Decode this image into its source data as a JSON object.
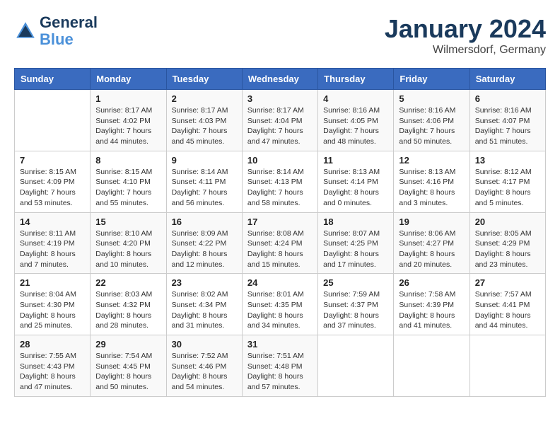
{
  "header": {
    "logo_line1": "General",
    "logo_line2": "Blue",
    "month": "January 2024",
    "location": "Wilmersdorf, Germany"
  },
  "weekdays": [
    "Sunday",
    "Monday",
    "Tuesday",
    "Wednesday",
    "Thursday",
    "Friday",
    "Saturday"
  ],
  "weeks": [
    [
      {
        "num": "",
        "info": ""
      },
      {
        "num": "1",
        "info": "Sunrise: 8:17 AM\nSunset: 4:02 PM\nDaylight: 7 hours\nand 44 minutes."
      },
      {
        "num": "2",
        "info": "Sunrise: 8:17 AM\nSunset: 4:03 PM\nDaylight: 7 hours\nand 45 minutes."
      },
      {
        "num": "3",
        "info": "Sunrise: 8:17 AM\nSunset: 4:04 PM\nDaylight: 7 hours\nand 47 minutes."
      },
      {
        "num": "4",
        "info": "Sunrise: 8:16 AM\nSunset: 4:05 PM\nDaylight: 7 hours\nand 48 minutes."
      },
      {
        "num": "5",
        "info": "Sunrise: 8:16 AM\nSunset: 4:06 PM\nDaylight: 7 hours\nand 50 minutes."
      },
      {
        "num": "6",
        "info": "Sunrise: 8:16 AM\nSunset: 4:07 PM\nDaylight: 7 hours\nand 51 minutes."
      }
    ],
    [
      {
        "num": "7",
        "info": "Sunrise: 8:15 AM\nSunset: 4:09 PM\nDaylight: 7 hours\nand 53 minutes."
      },
      {
        "num": "8",
        "info": "Sunrise: 8:15 AM\nSunset: 4:10 PM\nDaylight: 7 hours\nand 55 minutes."
      },
      {
        "num": "9",
        "info": "Sunrise: 8:14 AM\nSunset: 4:11 PM\nDaylight: 7 hours\nand 56 minutes."
      },
      {
        "num": "10",
        "info": "Sunrise: 8:14 AM\nSunset: 4:13 PM\nDaylight: 7 hours\nand 58 minutes."
      },
      {
        "num": "11",
        "info": "Sunrise: 8:13 AM\nSunset: 4:14 PM\nDaylight: 8 hours\nand 0 minutes."
      },
      {
        "num": "12",
        "info": "Sunrise: 8:13 AM\nSunset: 4:16 PM\nDaylight: 8 hours\nand 3 minutes."
      },
      {
        "num": "13",
        "info": "Sunrise: 8:12 AM\nSunset: 4:17 PM\nDaylight: 8 hours\nand 5 minutes."
      }
    ],
    [
      {
        "num": "14",
        "info": "Sunrise: 8:11 AM\nSunset: 4:19 PM\nDaylight: 8 hours\nand 7 minutes."
      },
      {
        "num": "15",
        "info": "Sunrise: 8:10 AM\nSunset: 4:20 PM\nDaylight: 8 hours\nand 10 minutes."
      },
      {
        "num": "16",
        "info": "Sunrise: 8:09 AM\nSunset: 4:22 PM\nDaylight: 8 hours\nand 12 minutes."
      },
      {
        "num": "17",
        "info": "Sunrise: 8:08 AM\nSunset: 4:24 PM\nDaylight: 8 hours\nand 15 minutes."
      },
      {
        "num": "18",
        "info": "Sunrise: 8:07 AM\nSunset: 4:25 PM\nDaylight: 8 hours\nand 17 minutes."
      },
      {
        "num": "19",
        "info": "Sunrise: 8:06 AM\nSunset: 4:27 PM\nDaylight: 8 hours\nand 20 minutes."
      },
      {
        "num": "20",
        "info": "Sunrise: 8:05 AM\nSunset: 4:29 PM\nDaylight: 8 hours\nand 23 minutes."
      }
    ],
    [
      {
        "num": "21",
        "info": "Sunrise: 8:04 AM\nSunset: 4:30 PM\nDaylight: 8 hours\nand 25 minutes."
      },
      {
        "num": "22",
        "info": "Sunrise: 8:03 AM\nSunset: 4:32 PM\nDaylight: 8 hours\nand 28 minutes."
      },
      {
        "num": "23",
        "info": "Sunrise: 8:02 AM\nSunset: 4:34 PM\nDaylight: 8 hours\nand 31 minutes."
      },
      {
        "num": "24",
        "info": "Sunrise: 8:01 AM\nSunset: 4:35 PM\nDaylight: 8 hours\nand 34 minutes."
      },
      {
        "num": "25",
        "info": "Sunrise: 7:59 AM\nSunset: 4:37 PM\nDaylight: 8 hours\nand 37 minutes."
      },
      {
        "num": "26",
        "info": "Sunrise: 7:58 AM\nSunset: 4:39 PM\nDaylight: 8 hours\nand 41 minutes."
      },
      {
        "num": "27",
        "info": "Sunrise: 7:57 AM\nSunset: 4:41 PM\nDaylight: 8 hours\nand 44 minutes."
      }
    ],
    [
      {
        "num": "28",
        "info": "Sunrise: 7:55 AM\nSunset: 4:43 PM\nDaylight: 8 hours\nand 47 minutes."
      },
      {
        "num": "29",
        "info": "Sunrise: 7:54 AM\nSunset: 4:45 PM\nDaylight: 8 hours\nand 50 minutes."
      },
      {
        "num": "30",
        "info": "Sunrise: 7:52 AM\nSunset: 4:46 PM\nDaylight: 8 hours\nand 54 minutes."
      },
      {
        "num": "31",
        "info": "Sunrise: 7:51 AM\nSunset: 4:48 PM\nDaylight: 8 hours\nand 57 minutes."
      },
      {
        "num": "",
        "info": ""
      },
      {
        "num": "",
        "info": ""
      },
      {
        "num": "",
        "info": ""
      }
    ]
  ]
}
